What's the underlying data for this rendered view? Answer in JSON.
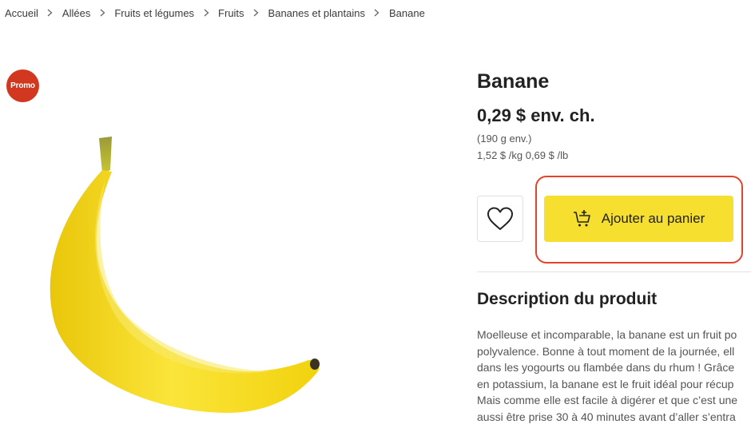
{
  "breadcrumb": [
    "Accueil",
    "Allées",
    "Fruits et légumes",
    "Fruits",
    "Bananes et plantains",
    "Banane"
  ],
  "badge": {
    "label": "Promo",
    "color": "#d2381f"
  },
  "product": {
    "title": "Banane",
    "price": "0,29 $ env. ch.",
    "weight": "(190 g env.)",
    "unit_prices": "1,52 $ /kg 0,69 $ /lb",
    "image_icon": "banana-image"
  },
  "actions": {
    "favorite_icon": "heart-icon",
    "add_to_cart_label": "Ajouter au panier",
    "add_to_cart_icon": "cart-plus-icon",
    "accent_color": "#f7df30",
    "highlight_color": "#e2432a"
  },
  "description": {
    "heading": "Description du produit",
    "lines": [
      "Moelleuse et incomparable, la banane est un fruit po",
      "polyvalence. Bonne à tout moment de la journée, ell",
      "dans les yogourts ou flambée dans du rhum ! Grâce",
      "en potassium, la banane est le fruit idéal pour récup",
      "Mais comme elle est facile à digérer et que c’est une",
      "aussi être prise 30 à 40 minutes avant d’aller s’entra"
    ]
  }
}
